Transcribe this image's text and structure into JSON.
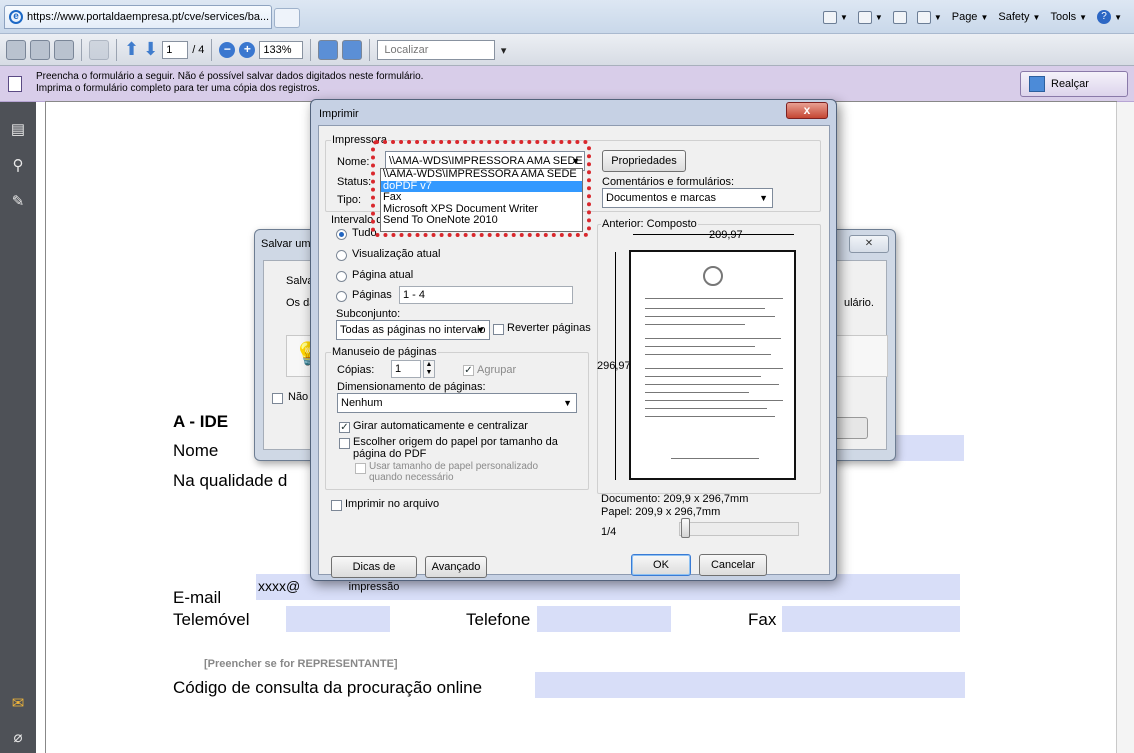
{
  "browser": {
    "tab_title": "https://www.portaldaempresa.pt/cve/services/ba...",
    "cmd_page": "Page",
    "cmd_safety": "Safety",
    "cmd_tools": "Tools"
  },
  "pdf_toolbar": {
    "page_current": "1",
    "page_total": "/ 4",
    "zoom": "133%",
    "search_placeholder": "Localizar"
  },
  "notice": {
    "line1": "Preencha o formulário a seguir. Não é possível salvar dados digitados neste formulário.",
    "line2": "Imprima o formulário completo para ter uma cópia dos registros.",
    "highlight_button": "Realçar campos"
  },
  "document": {
    "section_heading": "A - IDE",
    "nome_label": "Nome",
    "qualidade_label": "Na qualidade d",
    "email_label": "E-mail",
    "email_value": "xxxx@",
    "telemovel_label": "Telemóvel",
    "telefone_label": "Telefone",
    "fax_label": "Fax",
    "representante_note": "[Preencher se for REPRESENTANTE]",
    "procuracao_label": "Código de consulta da procuração online",
    "underscores_long": "_____________________________________________________________",
    "underscores_short": "____________"
  },
  "save_dialog": {
    "title": "Salvar uma",
    "close": "✕",
    "line1": "Salvar u",
    "line2": "Os da",
    "line2_end": "ulário.",
    "checkbox_label": "Não m"
  },
  "print_dialog": {
    "title": "Imprimir",
    "close": "x",
    "printer_group": "Impressora",
    "name_label": "Nome:",
    "name_value": "\\\\AMA-WDS\\IMPRESSORA AMA SEDE",
    "status_label": "Status:",
    "type_label": "Tipo:",
    "properties_button": "Propriedades",
    "comments_label": "Comentários e formulários:",
    "comments_value": "Documentos e marcas",
    "printer_options": [
      "\\\\AMA-WDS\\IMPRESSORA AMA SEDE",
      "doPDF v7",
      "Fax",
      "Microsoft XPS Document Writer",
      "Send To OneNote 2010"
    ],
    "range_group": "Intervalo d",
    "range_all": "Tudo",
    "range_current_view": "Visualização atual",
    "range_current_page": "Página atual",
    "range_pages": "Páginas",
    "range_pages_value": "1 - 4",
    "subset_label": "Subconjunto:",
    "subset_value": "Todas as páginas no intervalo",
    "reverse_label": "Reverter páginas",
    "handling_group": "Manuseio de páginas",
    "copies_label": "Cópias:",
    "copies_value": "1",
    "collate_label": "Agrupar",
    "sizing_label": "Dimensionamento de páginas:",
    "sizing_value": "Nenhum",
    "auto_rotate_label": "Girar automaticamente e centralizar",
    "choose_source_label": "Escolher origem do papel por tamanho da página do PDF",
    "custom_paper_label": "Usar tamanho de papel personalizado quando necessário",
    "print_to_file_label": "Imprimir no arquivo",
    "preview_label": "Anterior: Composto",
    "width_dim": "209,97",
    "height_dim": "296,97",
    "document_size": "Documento: 209,9 x 296,7mm",
    "paper_size": "Papel: 209,9 x 296,7mm",
    "page_indicator": "1/4",
    "tips_button": "Dicas de impressão",
    "advanced_button": "Avançado",
    "ok_button": "OK",
    "cancel_button": "Cancelar"
  }
}
